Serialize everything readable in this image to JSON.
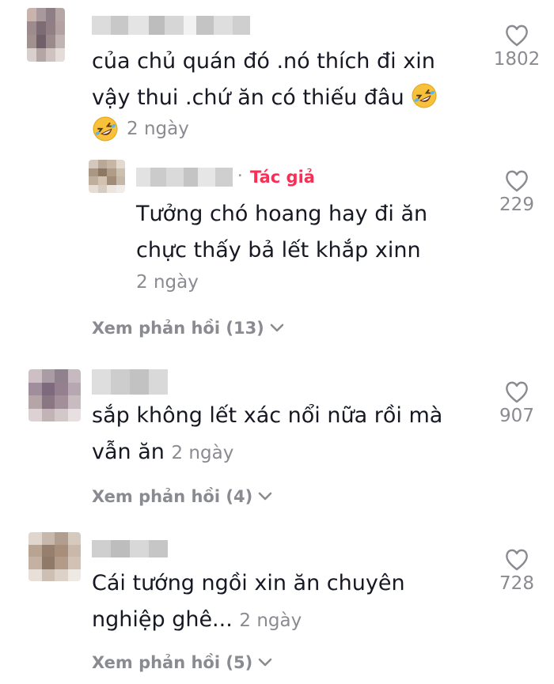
{
  "comments": [
    {
      "line1": "của chủ quán đó .nó thích đi xin",
      "line2": "vậy thui .chứ ăn có thiếu đâu",
      "time": "2 ngày",
      "likes": "1802",
      "emoji": "rolling-on-floor-laughing"
    },
    {
      "author_tag": "Tác giả",
      "line1": "Tưởng chó hoang hay đi ăn",
      "line2": "chực thấy bả lết khắp xinn",
      "time": "2 ngày",
      "likes": "229"
    },
    {
      "line1": "sắp không lết xác nổi nữa rồi mà",
      "line2": "vẫn ăn",
      "time": "2 ngày",
      "likes": "907"
    },
    {
      "line1": "Cái tướng ngồi xin ăn chuyên",
      "line2": "nghiệp ghê...",
      "time": "2 ngày",
      "likes": "728"
    }
  ],
  "view_replies": [
    "Xem phản hồi (13)",
    "Xem phản hồi (4)",
    "Xem phản hồi (5)"
  ],
  "colors": {
    "text": "#161823",
    "secondary": "#8a8b91",
    "author_tag": "#fe2c55"
  }
}
